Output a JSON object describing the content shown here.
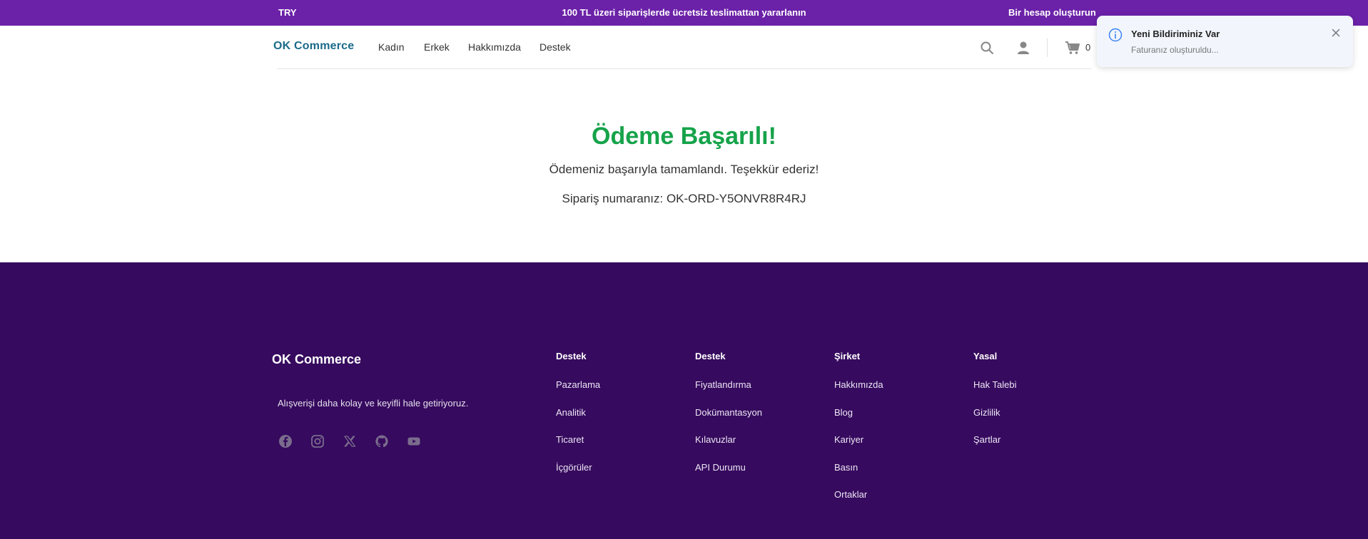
{
  "topbar": {
    "currency": "TRY",
    "promo": "100 TL üzeri siparişlerde ücretsiz teslimattan yararlanın",
    "signup": "Bir hesap oluşturun"
  },
  "nav": {
    "brand": "OK Commerce",
    "links": [
      "Kadın",
      "Erkek",
      "Hakkımızda",
      "Destek"
    ],
    "cart_count": "0",
    "icons": [
      "search-icon",
      "user-icon",
      "cart-icon"
    ]
  },
  "main": {
    "title": "Ödeme Başarılı!",
    "message": "Ödemeniz başarıyla tamamlandı. Teşekkür ederiz!",
    "order_label": "Sipariş numaranız: OK-ORD-Y5ONVR8R4RJ"
  },
  "footer": {
    "brand": "OK Commerce",
    "tagline": "Alışverişi daha kolay ve keyifli hale getiriyoruz.",
    "social": [
      "facebook-icon",
      "instagram-icon",
      "x-icon",
      "github-icon",
      "youtube-icon"
    ],
    "columns": [
      {
        "title": "Destek",
        "items": [
          "Pazarlama",
          "Analitik",
          "Ticaret",
          "İçgörüler"
        ]
      },
      {
        "title": "Destek",
        "items": [
          "Fiyatlandırma",
          "Dokümantasyon",
          "Kılavuzlar",
          "API Durumu"
        ]
      },
      {
        "title": "Şirket",
        "items": [
          "Hakkımızda",
          "Blog",
          "Kariyer",
          "Basın",
          "Ortaklar"
        ]
      },
      {
        "title": "Yasal",
        "items": [
          "Hak Talebi",
          "Gizlilik",
          "Şartlar"
        ]
      }
    ]
  },
  "toast": {
    "title": "Yeni Bildiriminiz Var",
    "body": "Faturanız oluşturuldu..."
  },
  "colors": {
    "topbar": "#6b21a8",
    "footer": "#360a5e",
    "success": "#16a34a",
    "brand": "#1b6b8a"
  }
}
